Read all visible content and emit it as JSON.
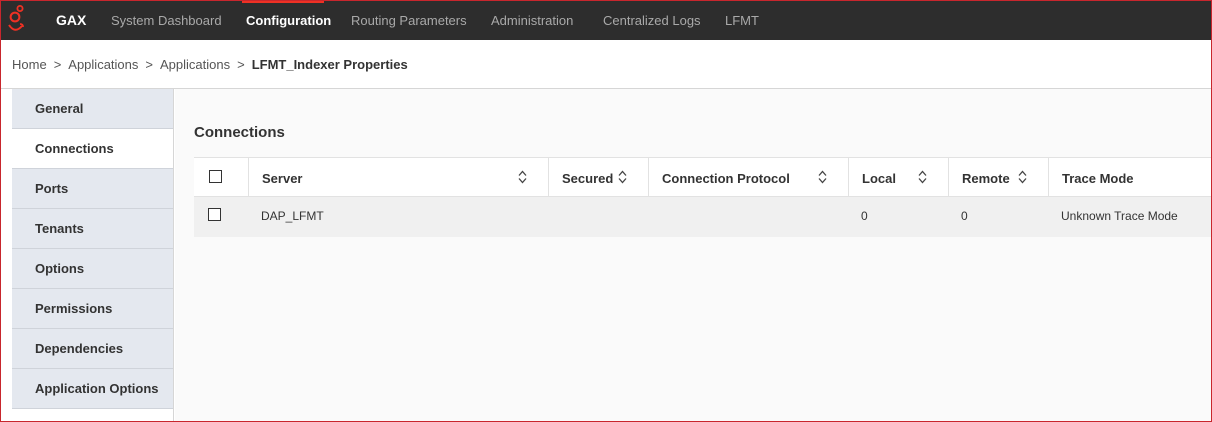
{
  "nav": {
    "brand": "GAX",
    "items": [
      "System Dashboard",
      "Configuration",
      "Routing Parameters",
      "Administration",
      "Centralized Logs",
      "LFMT"
    ],
    "active": "Configuration"
  },
  "breadcrumb": {
    "items": [
      "Home",
      "Applications",
      "Applications"
    ],
    "separator": ">",
    "current": "LFMT_Indexer Properties"
  },
  "sidebar": {
    "items": [
      {
        "label": "General"
      },
      {
        "label": "Connections"
      },
      {
        "label": "Ports"
      },
      {
        "label": "Tenants"
      },
      {
        "label": "Options"
      },
      {
        "label": "Permissions"
      },
      {
        "label": "Dependencies"
      },
      {
        "label": "Application Options"
      }
    ],
    "active": "Connections"
  },
  "main": {
    "title": "Connections",
    "table": {
      "columns": [
        {
          "label": "Server",
          "sortable": true
        },
        {
          "label": "Secured",
          "sortable": true
        },
        {
          "label": "Connection Protocol",
          "sortable": true
        },
        {
          "label": "Local",
          "sortable": true
        },
        {
          "label": "Remote",
          "sortable": true
        },
        {
          "label": "Trace Mode",
          "sortable": false
        }
      ],
      "rows": [
        {
          "server": "DAP_LFMT",
          "secured": "",
          "protocol": "",
          "local": "0",
          "remote": "0",
          "trace_mode": "Unknown Trace Mode"
        }
      ]
    }
  },
  "colors": {
    "nav_bg": "#2d2d2d",
    "accent": "#ee3124",
    "sidebar_bg": "#e4e8ef"
  },
  "icons": {
    "logo": "genesys-logo-icon",
    "sort": "sort-arrows-icon",
    "checkbox": "checkbox-icon"
  }
}
